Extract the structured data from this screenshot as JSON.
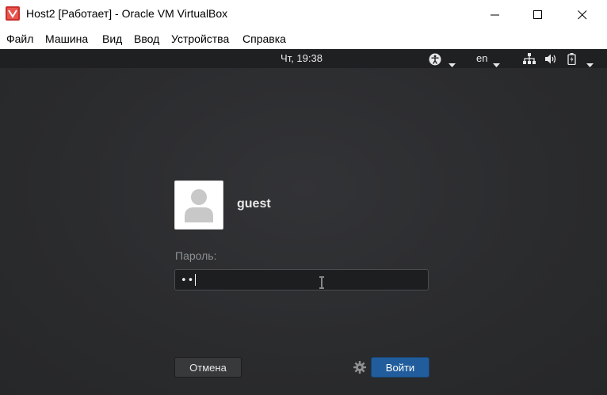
{
  "window": {
    "title": "Host2 [Работает] - Oracle VM VirtualBox",
    "app_icon": "virtualbox-icon",
    "controls": [
      "minimize-icon",
      "maximize-icon",
      "close-icon"
    ]
  },
  "menubar": {
    "items": [
      "Файл",
      "Машина",
      "Вид",
      "Ввод",
      "Устройства",
      "Справка"
    ]
  },
  "guest_topbar": {
    "clock": "Чт, 19:38",
    "language": "en",
    "icons": [
      "accessibility-icon",
      "network-icon",
      "volume-icon",
      "battery-icon"
    ]
  },
  "login": {
    "username": "guest",
    "password_label": "Пароль:",
    "password_value": "••",
    "cancel_label": "Отмена",
    "login_label": "Войти",
    "settings_icon": "gear-icon"
  },
  "colors": {
    "background": "#2b2c2e",
    "topbar": "#1f2022",
    "accent_button": "#215d9c"
  }
}
